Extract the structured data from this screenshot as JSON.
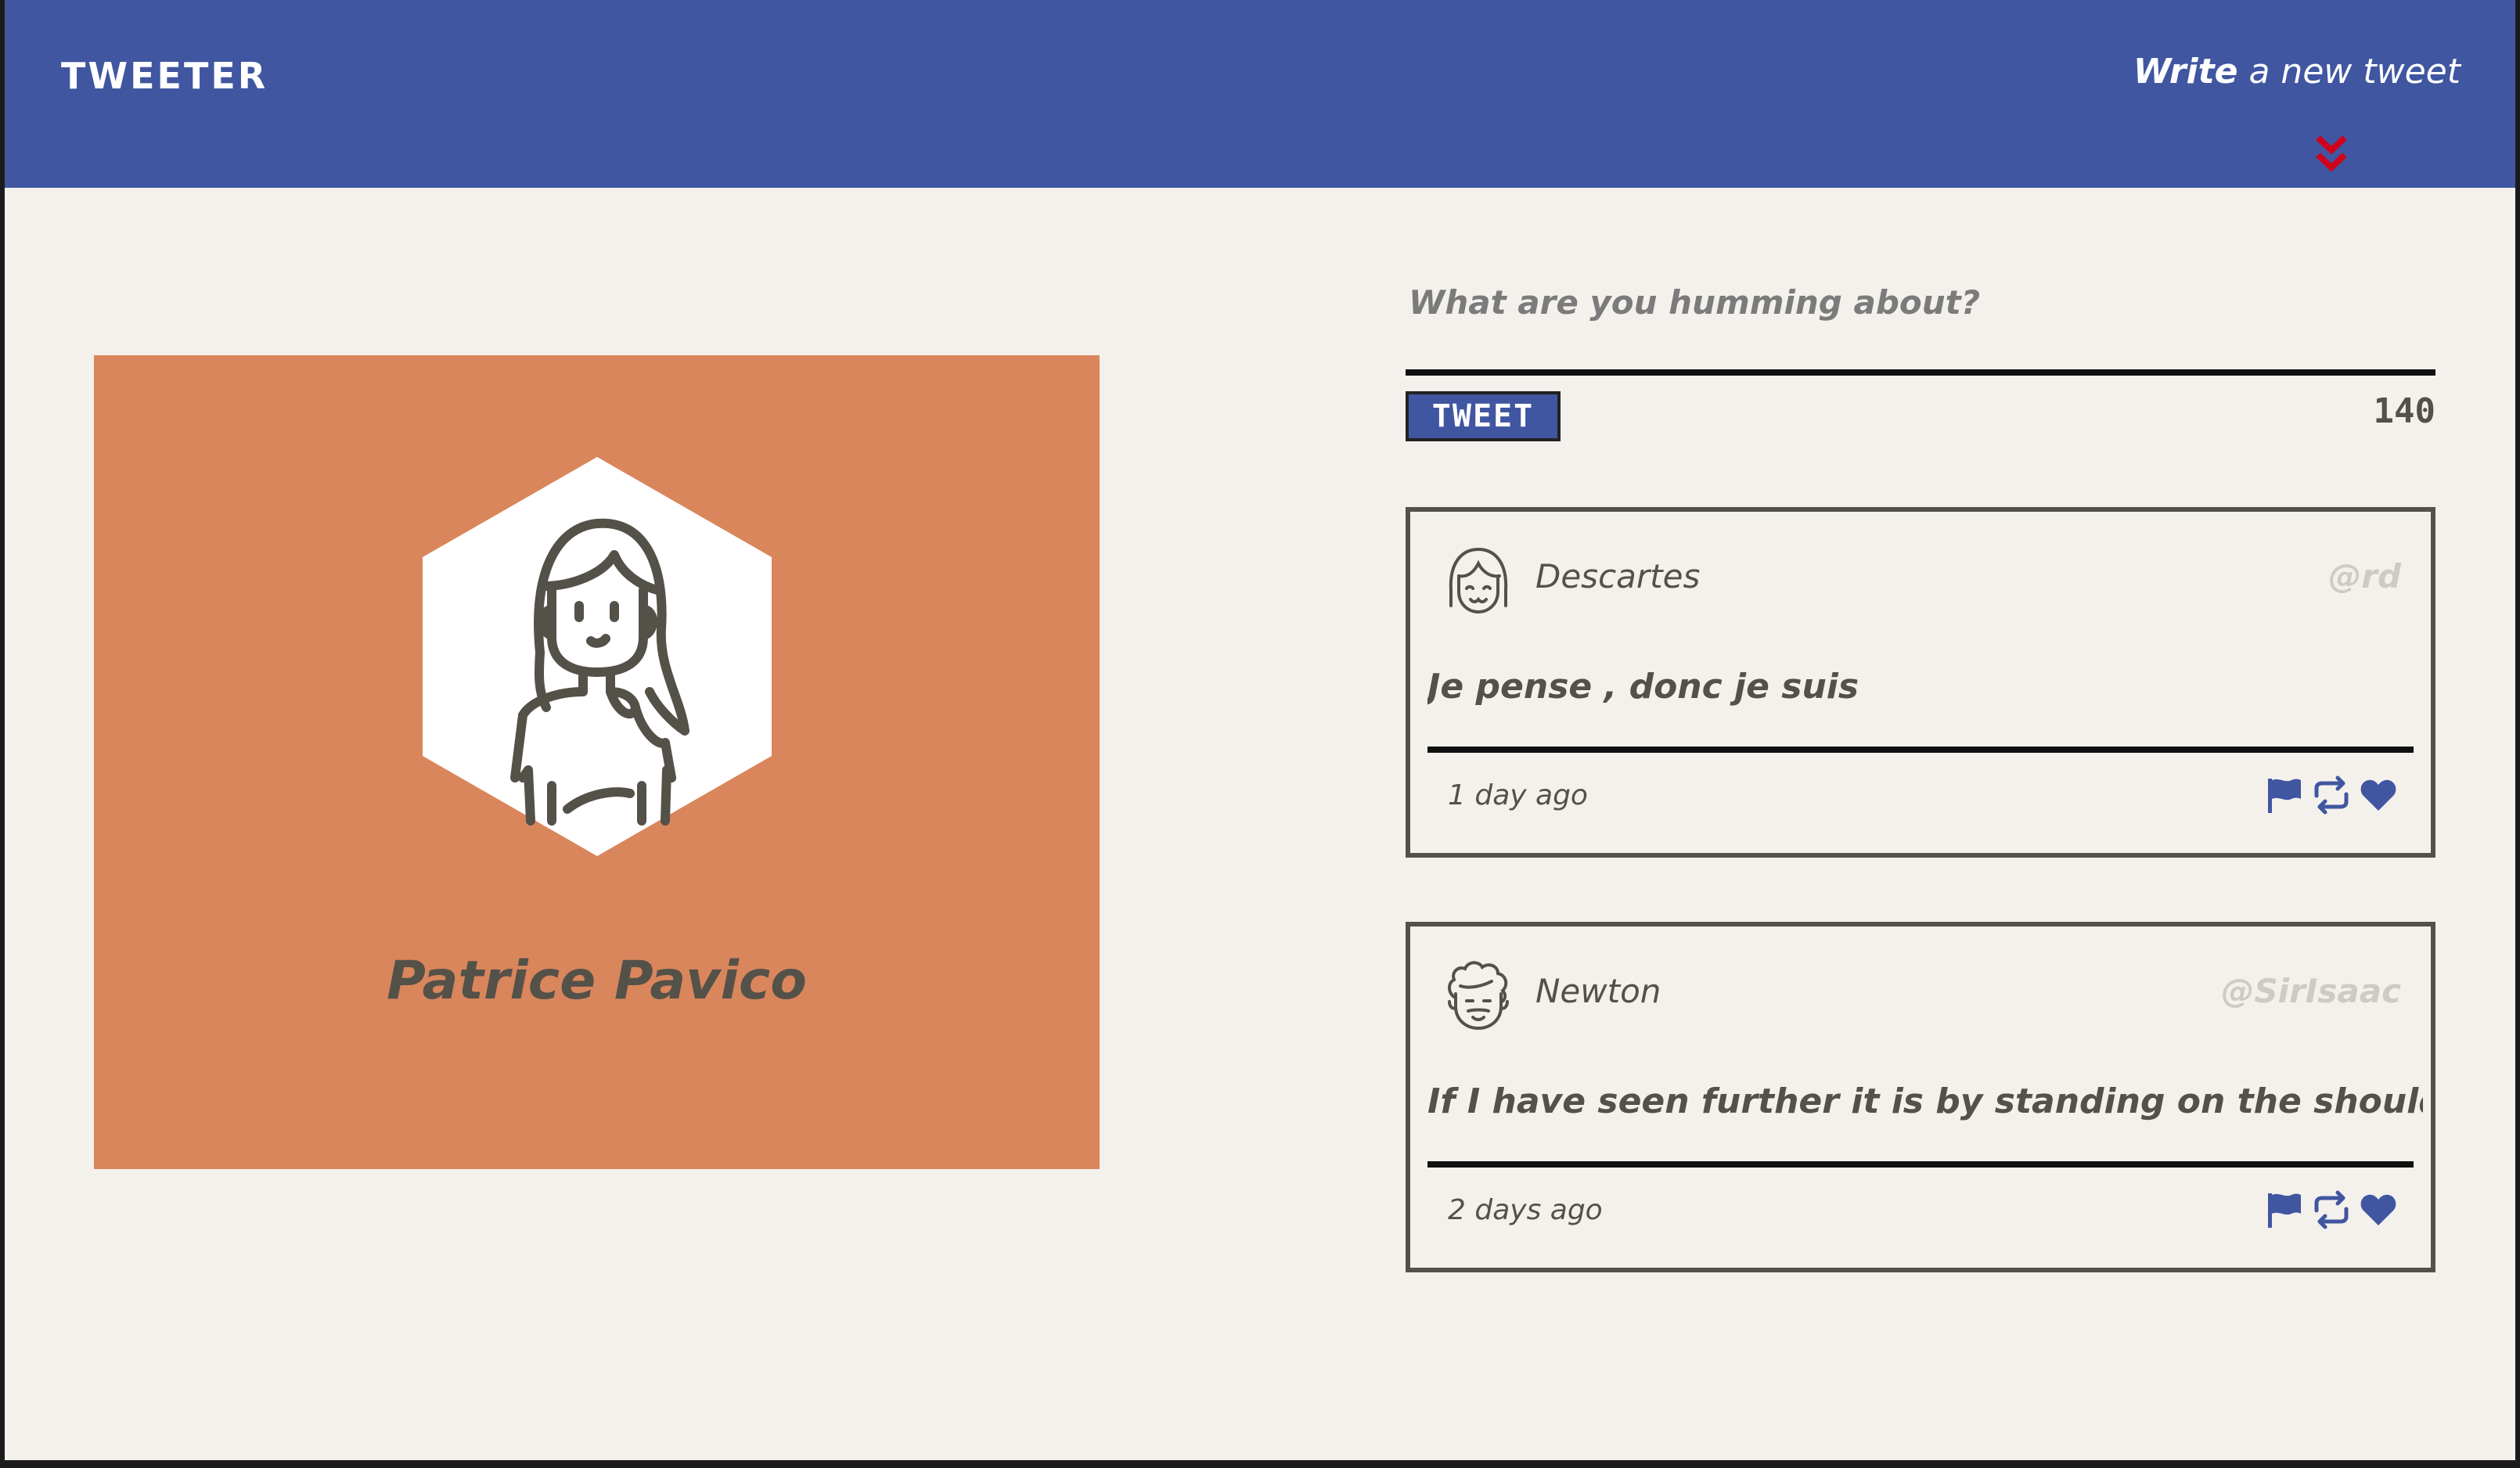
{
  "navbar": {
    "brand": "TWEETER",
    "compose_toggle": {
      "bold": "Write",
      "rest": " a new tweet"
    },
    "arrow_icon": "double-chevron-down-icon",
    "arrow_color": "#d0021b",
    "background": "#4056a1"
  },
  "profile": {
    "name": "Patrice Pavico",
    "background": "#d9865c"
  },
  "compose": {
    "placeholder": "What are you humming about?",
    "button_label": "TWEET",
    "counter": "140"
  },
  "tweets": [
    {
      "name": "Descartes",
      "handle": "@rd",
      "content": "Je pense , donc je suis",
      "time": "1 day ago",
      "avatar_icon": "descartes-avatar-icon"
    },
    {
      "name": "Newton",
      "handle": "@SirIsaac",
      "content": "If I have seen further it is by standing on the shoulders of giants",
      "time": "2 days ago",
      "avatar_icon": "newton-avatar-icon"
    }
  ],
  "actions": [
    "flag-icon",
    "retweet-icon",
    "heart-icon"
  ],
  "colors": {
    "accent": "#4056a1",
    "text": "#545149",
    "page_bg": "#f4f1ed"
  }
}
